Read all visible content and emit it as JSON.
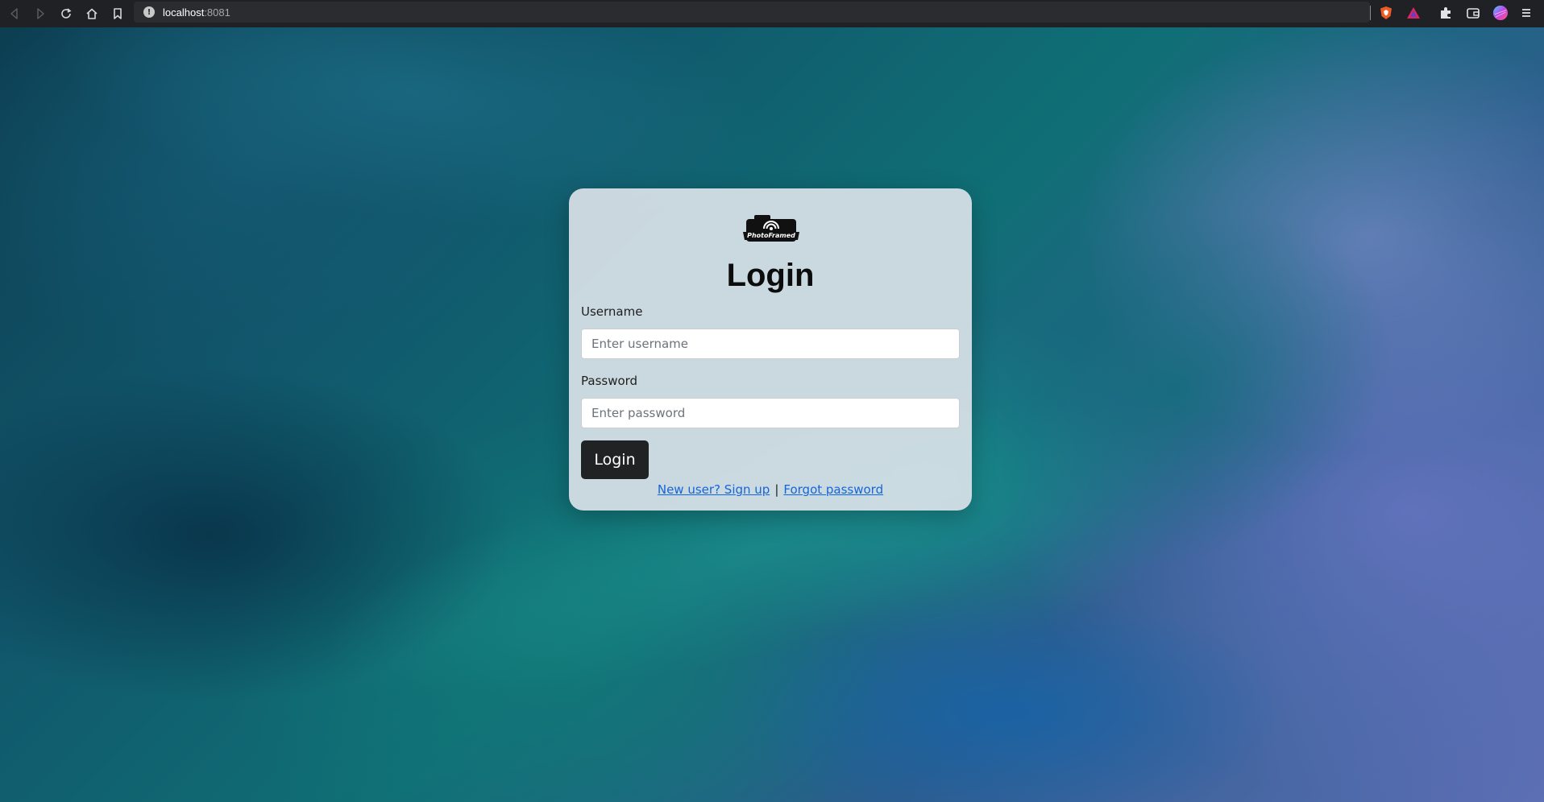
{
  "browser": {
    "url_host": "localhost",
    "url_port": ":8081",
    "nav_icons": [
      "back-icon",
      "forward-icon",
      "reload-icon",
      "home-icon",
      "bookmark-icon"
    ],
    "extension_icons": [
      "brave-shield-icon",
      "brave-rewards-icon",
      "extensions-icon",
      "wallet-icon",
      "profile-avatar-icon",
      "menu-icon"
    ]
  },
  "login": {
    "logo_text": "PhotoFramed",
    "title": "Login",
    "username_label": "Username",
    "username_placeholder": "Enter username",
    "password_label": "Password",
    "password_placeholder": "Enter password",
    "login_button": "Login",
    "signup_link": "New user? Sign up",
    "separator": "|",
    "forgot_link": "Forgot password"
  },
  "colors": {
    "button_bg": "#202224",
    "link": "#1565d8",
    "card_bg": "#dae2e8"
  }
}
